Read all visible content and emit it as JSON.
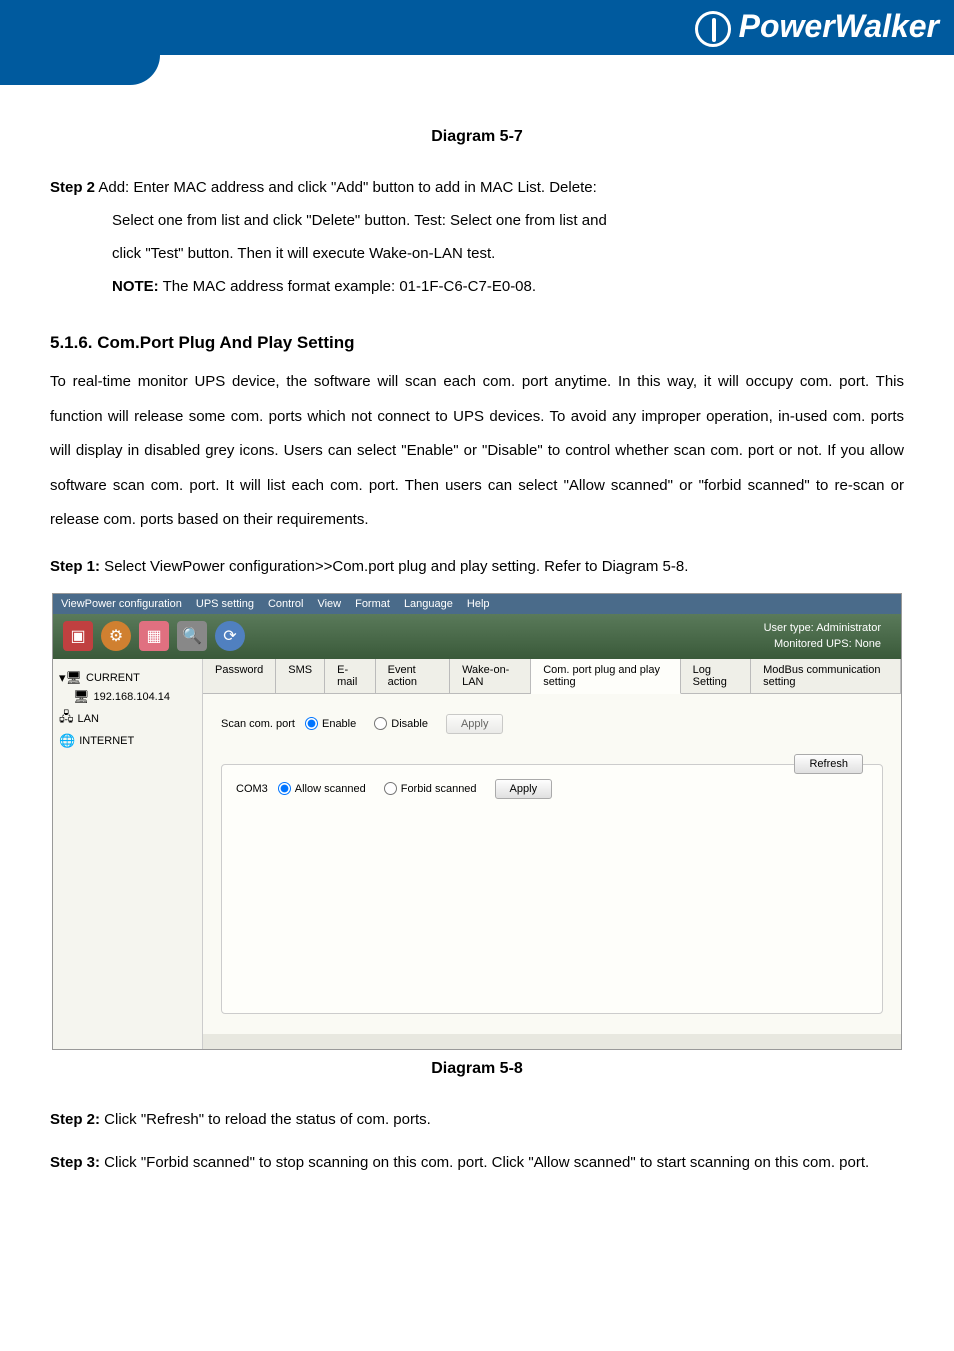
{
  "logo_text": "PowerWalker",
  "diagram_caption_top": "Diagram 5-7",
  "step2": {
    "label": "Step 2",
    "line1": "  Add: Enter MAC address and click \"Add\" button to add in MAC List. Delete:",
    "line2": "Select one from list and click \"Delete\" button. Test: Select one from list and",
    "line3": "click \"Test\" button. Then it will execute Wake-on-LAN test.",
    "note_label": "NOTE:",
    "note_text": " The MAC address format example: 01-1F-C6-C7-E0-08."
  },
  "section_heading": "5.1.6. Com.Port Plug And Play Setting",
  "body_para": "To real-time monitor UPS device, the software will scan each com. port anytime. In this way, it will occupy com. port. This function will release some com. ports which not connect to UPS devices. To avoid any improper operation, in-used com. ports will display in disabled grey icons. Users can select \"Enable\" or \"Disable\" to control whether scan com. port or not. If you allow software scan com. port. It will list each com. port. Then users can select \"Allow scanned\" or \"forbid scanned\" to re-scan or release com. ports based on their requirements.",
  "step1": {
    "label": "Step 1:",
    "text": " Select ViewPower configuration>>Com.port plug and play setting. Refer to Diagram 5-8."
  },
  "screenshot": {
    "menubar": [
      "ViewPower configuration",
      "UPS setting",
      "Control",
      "View",
      "Format",
      "Language",
      "Help"
    ],
    "user_type_label": "User type:",
    "user_type_value": "Administrator",
    "monitored_label": "Monitored UPS:",
    "monitored_value": "None",
    "tree": {
      "root": "CURRENT",
      "ip": "192.168.104.14",
      "lan": "LAN",
      "internet": "INTERNET"
    },
    "tabs": [
      "Password",
      "SMS",
      "E-mail",
      "Event action",
      "Wake-on-LAN",
      "Com. port plug and play setting",
      "Log Setting",
      "ModBus communication setting"
    ],
    "scan_label": "Scan com. port",
    "enable": "Enable",
    "disable": "Disable",
    "apply": "Apply",
    "refresh": "Refresh",
    "com_port": "COM3",
    "allow": "Allow scanned",
    "forbid": "Forbid scanned",
    "apply2": "Apply"
  },
  "diagram_caption_mid": "Diagram 5-8",
  "step2b": {
    "label": "Step 2:",
    "text": " Click \"Refresh\" to reload the status of com. ports."
  },
  "step3": {
    "label": "Step 3:",
    "text": " Click \"Forbid scanned\" to stop scanning on this com. port. Click \"Allow scanned\" to start scanning on this com. port."
  }
}
